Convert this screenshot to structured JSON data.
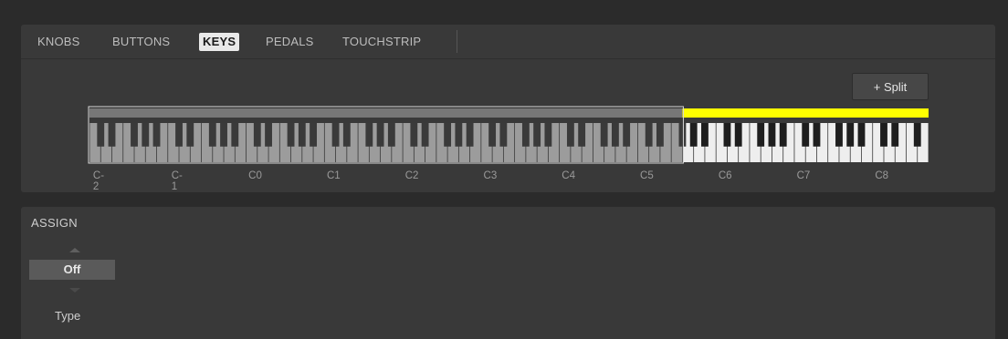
{
  "tabs": [
    {
      "label": "KNOBS",
      "active": false
    },
    {
      "label": "BUTTONS",
      "active": false
    },
    {
      "label": "KEYS",
      "active": true
    },
    {
      "label": "PEDALS",
      "active": false
    },
    {
      "label": "TOUCHSTRIP",
      "active": false
    }
  ],
  "split_button": {
    "label": "+ Split"
  },
  "keyboard": {
    "note_labels": [
      "C-2",
      "C-1",
      "C0",
      "C1",
      "C2",
      "C3",
      "C4",
      "C5",
      "C6",
      "C7",
      "C8"
    ],
    "zones": [
      {
        "start": "C-2",
        "end": "G5",
        "selected": true,
        "color": "#777777"
      },
      {
        "start": "G#5",
        "end": "G8",
        "selected": false,
        "color": "#ffff00"
      }
    ]
  },
  "assign": {
    "title": "ASSIGN",
    "value": "Off",
    "label": "Type"
  },
  "colors": {
    "split_zone": "#ffff00",
    "active_tab_bg": "#e9e9e9",
    "panel_bg": "#393939"
  }
}
